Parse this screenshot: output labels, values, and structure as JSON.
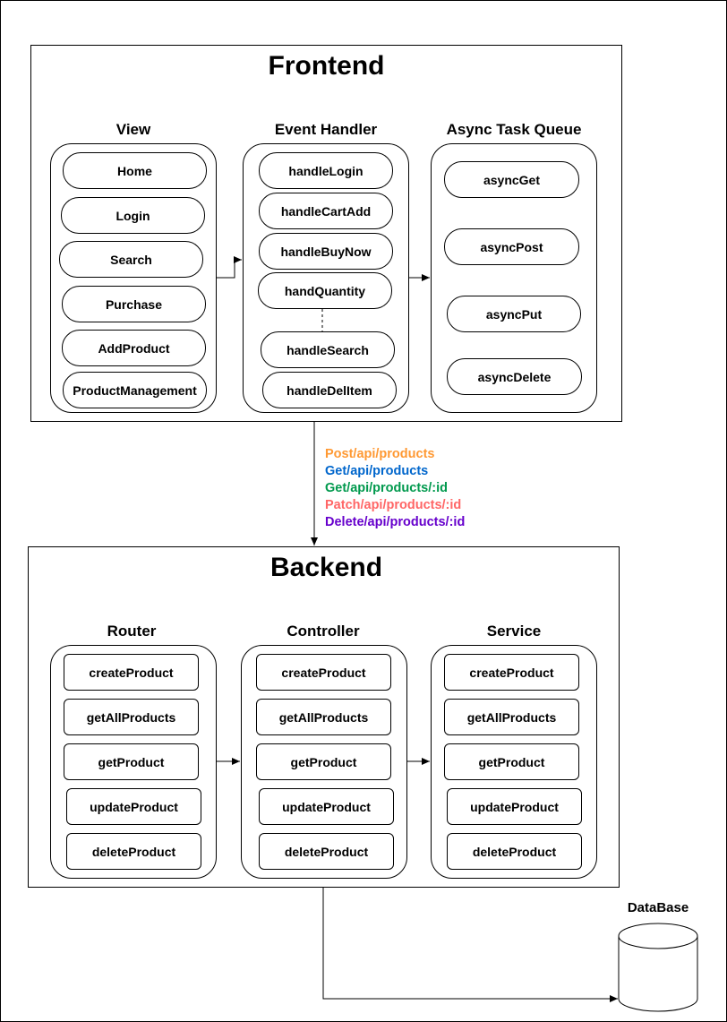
{
  "frontend": {
    "title": "Frontend",
    "view": {
      "title": "View",
      "items": [
        "Home",
        "Login",
        "Search",
        "Purchase",
        "AddProduct",
        "ProductManagement"
      ]
    },
    "event_handler": {
      "title": "Event Handler",
      "items": [
        "handleLogin",
        "handleCartAdd",
        "handleBuyNow",
        "handQuantity",
        "handleSearch",
        "handleDelItem"
      ]
    },
    "async_queue": {
      "title": "Async Task Queue",
      "items": [
        "asyncGet",
        "asyncPost",
        "asyncPut",
        "asyncDelete"
      ]
    }
  },
  "api_routes": [
    {
      "text": "Post/api/products",
      "color": "#FF9933"
    },
    {
      "text": "Get/api/products",
      "color": "#0066CC"
    },
    {
      "text": "Get/api/products/:id",
      "color": "#00994D"
    },
    {
      "text": "Patch/api/products/:id",
      "color": "#FF6666"
    },
    {
      "text": "Delete/api/products/:id",
      "color": "#6600CC"
    }
  ],
  "backend": {
    "title": "Backend",
    "router": {
      "title": "Router",
      "items": [
        "createProduct",
        "getAllProducts",
        "getProduct",
        "updateProduct",
        "deleteProduct"
      ]
    },
    "controller": {
      "title": "Controller",
      "items": [
        "createProduct",
        "getAllProducts",
        "getProduct",
        "updateProduct",
        "deleteProduct"
      ]
    },
    "service": {
      "title": "Service",
      "items": [
        "createProduct",
        "getAllProducts",
        "getProduct",
        "updateProduct",
        "deleteProduct"
      ]
    }
  },
  "database": {
    "label": "DataBase"
  }
}
